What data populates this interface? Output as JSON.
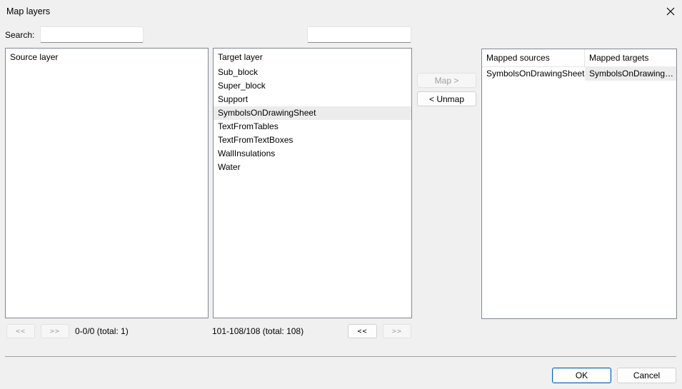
{
  "window": {
    "title": "Map layers"
  },
  "search": {
    "label": "Search:",
    "source_value": "",
    "target_value": ""
  },
  "source_list": {
    "header": "Source layer",
    "items": []
  },
  "target_list": {
    "header": "Target layer",
    "items": [
      "Sub_block",
      "Super_block",
      "Support",
      "SymbolsOnDrawingSheet",
      "TextFromTables",
      "TextFromTextBoxes",
      "WallInsulations",
      "Water"
    ],
    "selected_index": 3
  },
  "actions": {
    "map_label": "Map >",
    "unmap_label": "< Unmap"
  },
  "mapped": {
    "col_sources": "Mapped sources",
    "col_targets": "Mapped targets",
    "rows": [
      {
        "source": "SymbolsOnDrawingSheet",
        "target": "SymbolsOnDrawingSheet"
      }
    ]
  },
  "source_pager": {
    "prev": "<<",
    "next": ">>",
    "status": "0-0/0 (total: 1)"
  },
  "target_pager": {
    "prev": "<<",
    "next": ">>",
    "status": "101-108/108 (total: 108)"
  },
  "footer": {
    "ok_label": "OK",
    "cancel_label": "Cancel"
  }
}
